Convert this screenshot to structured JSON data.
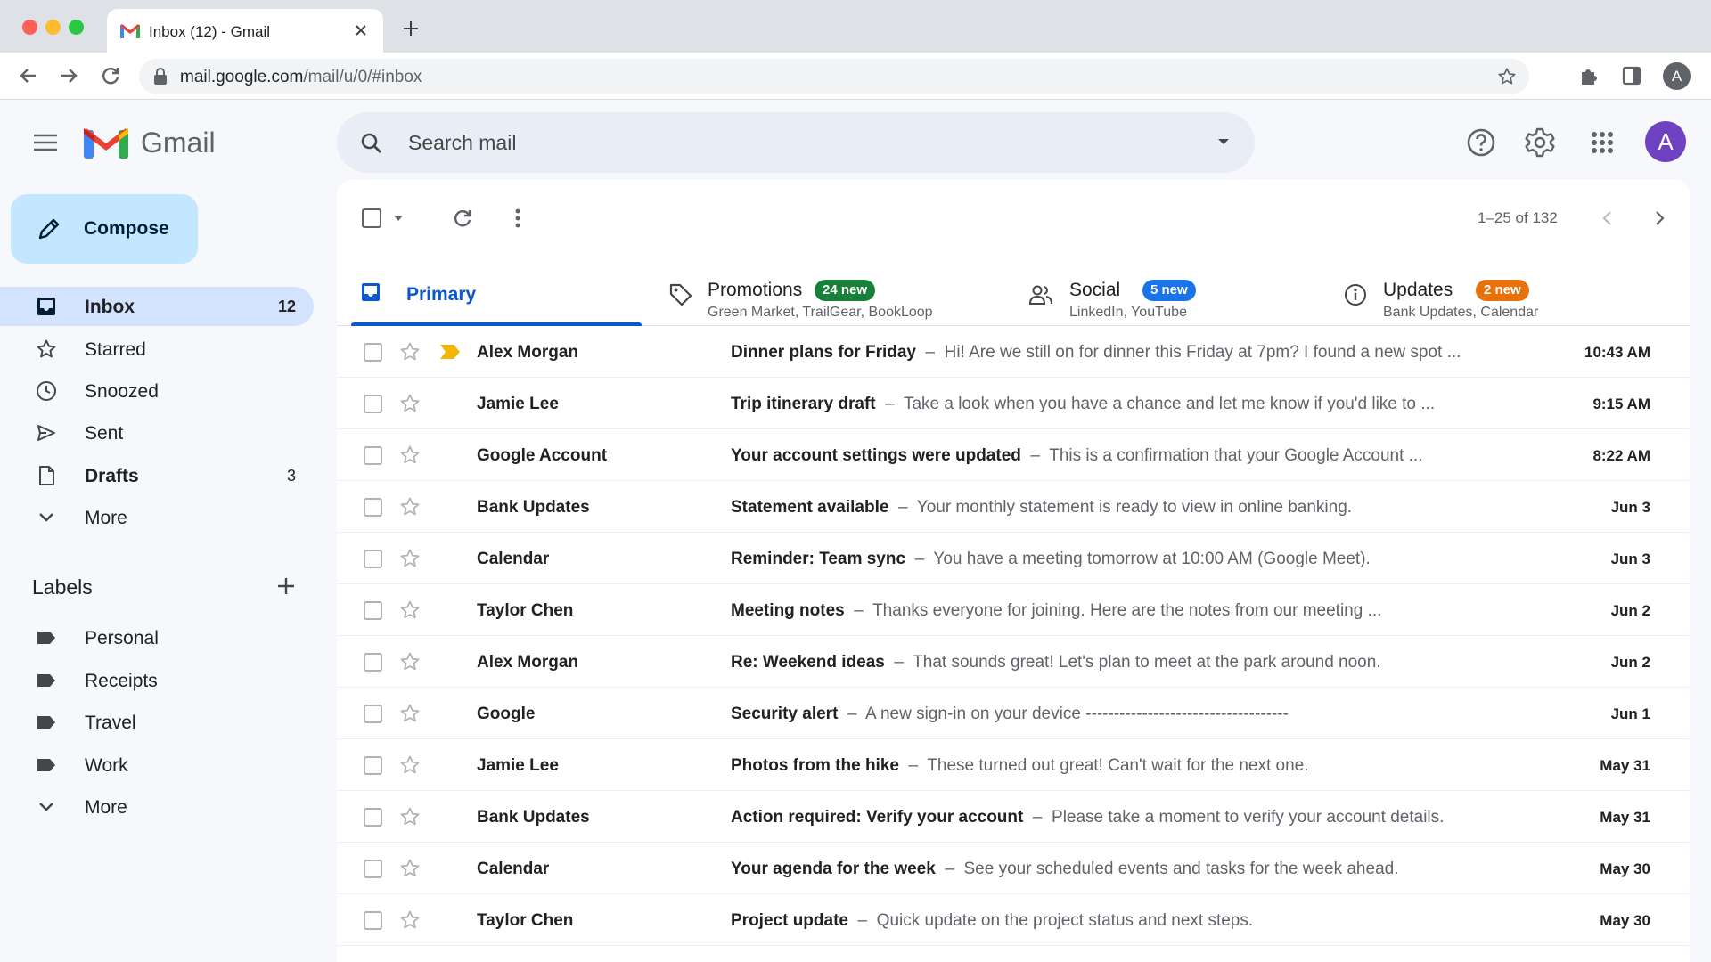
{
  "browser": {
    "tab_title": "Inbox (12) - Gmail",
    "url_host": "mail.google.com",
    "url_path": "/mail/u/0/#inbox",
    "profile_initial": "A"
  },
  "header": {
    "app_name": "Gmail",
    "search_placeholder": "Search mail",
    "avatar_initial": "A"
  },
  "sidebar": {
    "compose_label": "Compose",
    "items": [
      {
        "label": "Inbox",
        "count": "12"
      },
      {
        "label": "Starred",
        "count": ""
      },
      {
        "label": "Snoozed",
        "count": ""
      },
      {
        "label": "Sent",
        "count": ""
      },
      {
        "label": "Drafts",
        "count": "3"
      },
      {
        "label": "More",
        "count": ""
      }
    ],
    "labels_title": "Labels",
    "labels": [
      {
        "label": "Personal"
      },
      {
        "label": "Receipts"
      },
      {
        "label": "Travel"
      },
      {
        "label": "Work"
      }
    ],
    "labels_more": "More"
  },
  "toolbar": {
    "range": "1–25 of 132"
  },
  "tabs": [
    {
      "name": "Primary",
      "badge": "",
      "sub": "",
      "color": "#0b57d0"
    },
    {
      "name": "Promotions",
      "badge": "24 new",
      "sub": "Green Market, TrailGear, BookLoop",
      "color": "#188038"
    },
    {
      "name": "Social",
      "badge": "5 new",
      "sub": "LinkedIn, YouTube",
      "color": "#1a73e8"
    },
    {
      "name": "Updates",
      "badge": "2 new",
      "sub": "Bank Updates, Calendar",
      "color": "#e8710a"
    }
  ],
  "emails": [
    {
      "sender": "Alex Morgan",
      "subject": "Dinner plans for Friday",
      "snippet": "Hi! Are we still on for dinner this Friday at 7pm? I found a new spot ...",
      "date": "10:43 AM",
      "important": true
    },
    {
      "sender": "Jamie Lee",
      "subject": "Trip itinerary draft",
      "snippet": "Take a look when you have a chance and let me know if you'd like to ...",
      "date": "9:15 AM",
      "important": false
    },
    {
      "sender": "Google Account",
      "subject": "Your account settings were updated",
      "snippet": "This is a confirmation that your Google Account ...",
      "date": "8:22 AM",
      "important": false
    },
    {
      "sender": "Bank Updates",
      "subject": "Statement available",
      "snippet": "Your monthly statement is ready to view in online banking.",
      "date": "Jun 3",
      "important": false
    },
    {
      "sender": "Calendar",
      "subject": "Reminder: Team sync",
      "snippet": "You have a meeting tomorrow at 10:00 AM (Google Meet).",
      "date": "Jun 3",
      "important": false
    },
    {
      "sender": "Taylor Chen",
      "subject": "Meeting notes",
      "snippet": "Thanks everyone for joining. Here are the notes from our meeting ...",
      "date": "Jun 2",
      "important": false
    },
    {
      "sender": "Alex Morgan",
      "subject": "Re: Weekend ideas",
      "snippet": "That sounds great! Let's plan to meet at the park around noon.",
      "date": "Jun 2",
      "important": false
    },
    {
      "sender": "Google",
      "subject": "Security alert",
      "snippet": "A new sign-in on your device ------------------------------------",
      "date": "Jun 1",
      "important": false
    },
    {
      "sender": "Jamie Lee",
      "subject": "Photos from the hike",
      "snippet": "These turned out great! Can't wait for the next one.",
      "date": "May 31",
      "important": false
    },
    {
      "sender": "Bank Updates",
      "subject": "Action required: Verify your account",
      "snippet": "Please take a moment to verify your account details.",
      "date": "May 31",
      "important": false
    },
    {
      "sender": "Calendar",
      "subject": "Your agenda for the week",
      "snippet": "See your scheduled events and tasks for the week ahead.",
      "date": "May 30",
      "important": false
    },
    {
      "sender": "Taylor Chen",
      "subject": "Project update",
      "snippet": "Quick update on the project status and next steps.",
      "date": "May 30",
      "important": false
    }
  ],
  "colors": {
    "accent": "#0b57d0",
    "compose_bg": "#c2e7ff",
    "active_nav": "#d3e3fd",
    "important_marker": "#f2b705"
  }
}
